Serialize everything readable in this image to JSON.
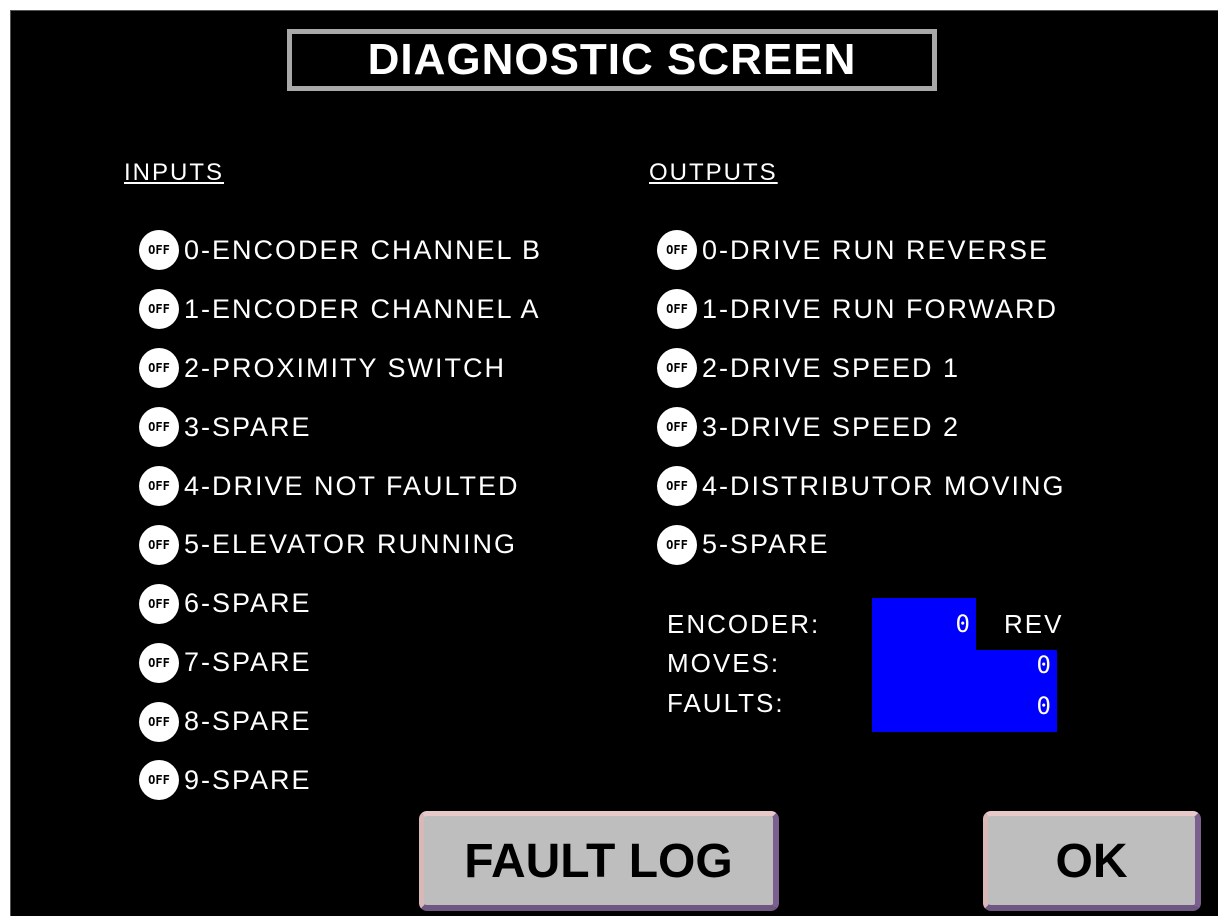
{
  "title": "DIAGNOSTIC SCREEN",
  "inputs": {
    "heading": "INPUTS",
    "items": [
      {
        "state": "OFF",
        "label": "0-ENCODER CHANNEL B"
      },
      {
        "state": "OFF",
        "label": "1-ENCODER CHANNEL A"
      },
      {
        "state": "OFF",
        "label": "2-PROXIMITY SWITCH"
      },
      {
        "state": "OFF",
        "label": "3-SPARE"
      },
      {
        "state": "OFF",
        "label": "4-DRIVE NOT FAULTED"
      },
      {
        "state": "OFF",
        "label": "5-ELEVATOR RUNNING"
      },
      {
        "state": "OFF",
        "label": "6-SPARE"
      },
      {
        "state": "OFF",
        "label": "7-SPARE"
      },
      {
        "state": "OFF",
        "label": "8-SPARE"
      },
      {
        "state": "OFF",
        "label": "9-SPARE"
      }
    ]
  },
  "outputs": {
    "heading": "OUTPUTS",
    "items": [
      {
        "state": "OFF",
        "label": "0-DRIVE RUN REVERSE"
      },
      {
        "state": "OFF",
        "label": "1-DRIVE RUN FORWARD"
      },
      {
        "state": "OFF",
        "label": "2-DRIVE SPEED 1"
      },
      {
        "state": "OFF",
        "label": "3-DRIVE SPEED 2"
      },
      {
        "state": "OFF",
        "label": "4-DISTRIBUTOR MOVING"
      },
      {
        "state": "OFF",
        "label": "5-SPARE"
      }
    ]
  },
  "counters": {
    "encoder": {
      "label": "ENCODER:",
      "value": "0",
      "unit": "REV"
    },
    "moves": {
      "label": "MOVES:",
      "value": "0"
    },
    "faults": {
      "label": "FAULTS:",
      "value": "0"
    }
  },
  "buttons": {
    "fault_log": "FAULT LOG",
    "ok": "OK"
  },
  "colors": {
    "background": "#000000",
    "counter_fill": "#0000ff",
    "lamp_off": "#ffffff",
    "button_face": "#bebebe"
  }
}
